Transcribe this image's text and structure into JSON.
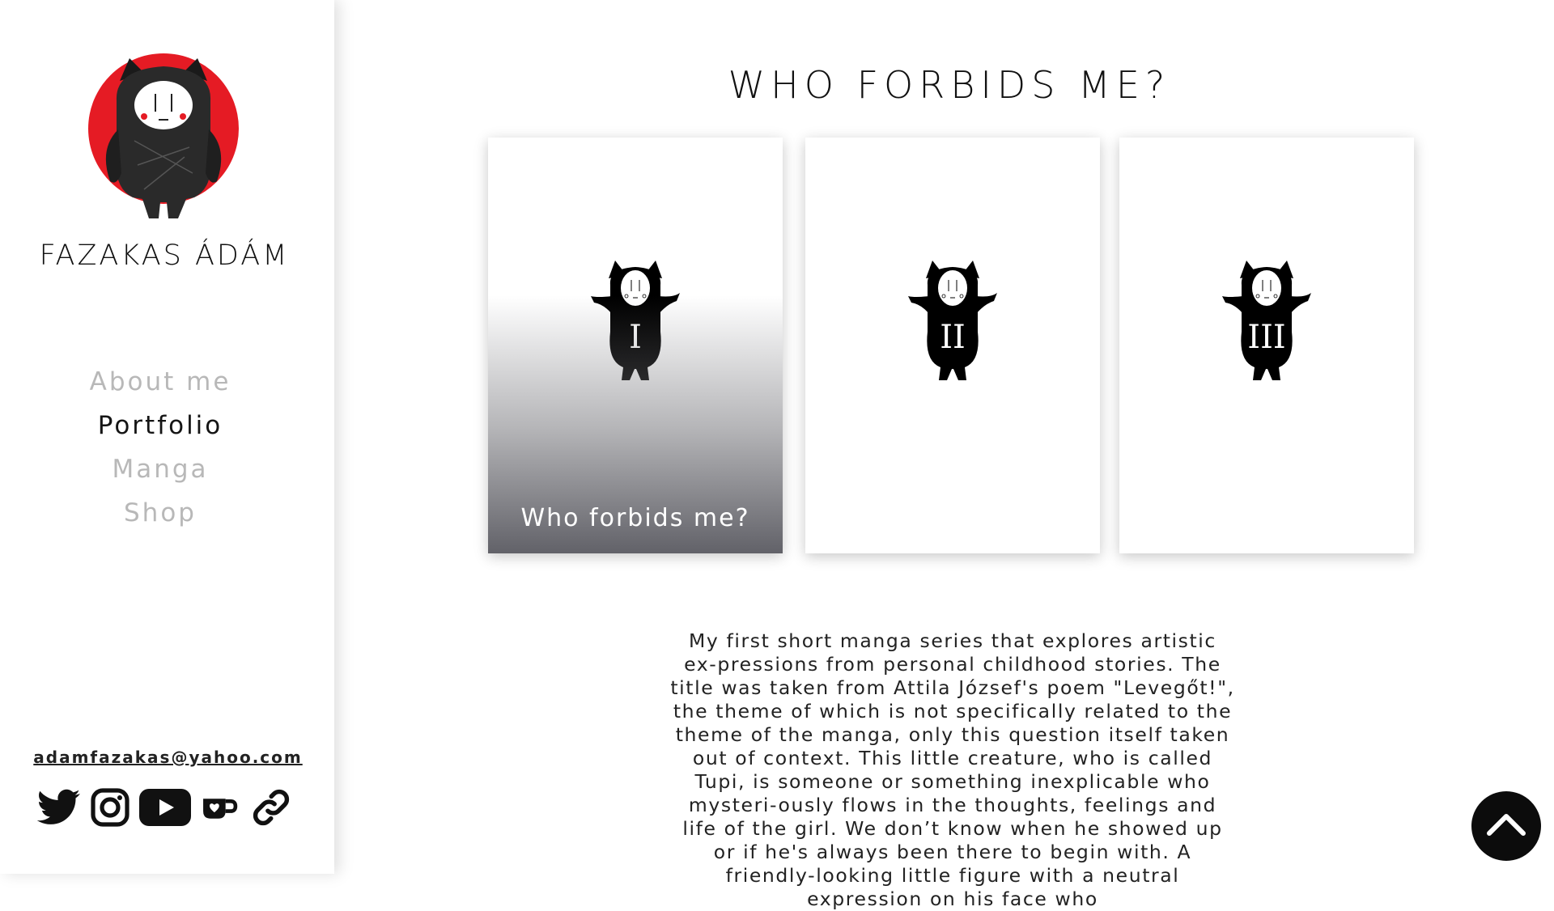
{
  "sidebar": {
    "site_title": "FAZAKAS ÁDÁM",
    "nav": [
      {
        "label": "About me",
        "active": false
      },
      {
        "label": "Portfolio",
        "active": true
      },
      {
        "label": "Manga",
        "active": false
      },
      {
        "label": "Shop",
        "active": false
      }
    ],
    "email": "adamfazakas@yahoo.com",
    "social_icons": [
      "twitter-icon",
      "instagram-icon",
      "youtube-icon",
      "kofi-icon",
      "link-icon"
    ]
  },
  "main": {
    "title": "WHO FORBIDS ME?",
    "cards": [
      {
        "caption": "Who forbids me?",
        "volume_marks": "I"
      },
      {
        "caption": "",
        "volume_marks": "II"
      },
      {
        "caption": "",
        "volume_marks": "III"
      }
    ],
    "description": "My first short manga series that explores artistic ex-pressions from personal childhood stories. The title was taken from Attila József's poem \"Levegőt!\", the theme of which is not specifically related to the theme of the manga, only this question itself taken out of context. This little creature, who is called Tupi, is someone or something inexplicable who mysteri-ously flows in the thoughts, feelings and life of the girl. We don’t know when he showed up or if he's always been there to begin with. A friendly-looking little figure with a neutral expression on his face who"
  },
  "colors": {
    "logo_red": "#e51b24",
    "active_nav": "#151515",
    "inactive_nav": "#b8b8b8",
    "scroll_button": "#0c0c0c"
  }
}
